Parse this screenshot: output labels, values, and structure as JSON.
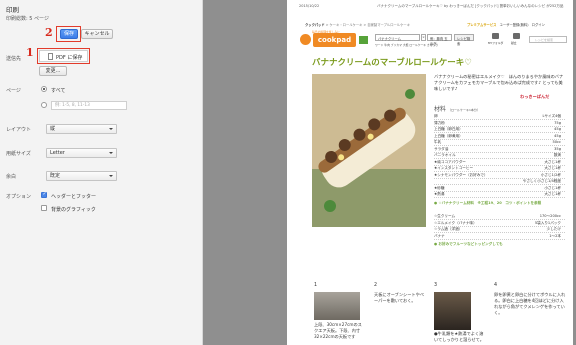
{
  "dialog": {
    "title": "印刷",
    "total_pages": "印刷総数: 5 ページ",
    "save_label": "保存",
    "cancel_label": "キャンセル",
    "destination_label": "送信先",
    "destination_value": "PDF に保存",
    "change_label": "変更...",
    "pages_label": "ページ",
    "pages_all": "すべて",
    "pages_placeholder": "例: 1-5, 8, 11-13",
    "layout_label": "レイアウト",
    "layout_value": "縦",
    "paper_label": "用紙サイズ",
    "paper_value": "Letter",
    "margin_label": "余白",
    "margin_value": "既定",
    "options_label": "オプション",
    "opt_header_footer": "ヘッダーとフッター",
    "opt_background": "背景のグラフィック"
  },
  "annotations": {
    "num1": "1",
    "num2": "2"
  },
  "preview": {
    "date": "2015/10/22",
    "header_title": "バナナクリームのマーブルロールケーキ♡ by わっきーぱんだ [クックパッド] 簡単おいしいみんなのレシピ が252万品",
    "crumb_a": "クックパッド",
    "crumb_b": "> ケーキ・ロールケーキ > 自家製マーブルロールケーキ",
    "top_premium": "プレミアムサービス",
    "top_register": "ユーザー登録(無料)",
    "top_login": "ログイン",
    "logo": "cookpad",
    "logo_sub": "毎日の料理を楽しみに",
    "search_value": "バナナクリーム",
    "search_x": "×",
    "search_ph2": "例：豚肉 玉ねぎ",
    "search_btn": "レシピ検索",
    "search_hints": "ワード 牛肉 ブリカマ 大根 ロールケーキ きゅうり",
    "nav_mykitchen": "MYフォルダ",
    "nav_menu": "献立",
    "nav_search_ph": "レシピを検索",
    "recipe_title": "バナナクリームのマーブルロールケーキ♡",
    "description": "バナナクリームの秘密はエルメイク♡　ほんのりまろやか風味のバナナクリームをカフェモカマーブルで包み込めば完成です♪ とっても美味しいです♪",
    "tsukurepo": "わっきーぱんだ",
    "ing_title": "材料",
    "ing_note": "（ロールケーキ1本分）",
    "ingredients": [
      {
        "name": "卵",
        "value": "Lサイズ4個"
      },
      {
        "name": "薄力粉",
        "value": "75g"
      },
      {
        "name": "上白糖（卵白用）",
        "value": "45g"
      },
      {
        "name": "上白糖（卵黄用）",
        "value": "45g"
      },
      {
        "name": "牛乳",
        "value": "50cc"
      },
      {
        "name": "サラダ油",
        "value": "35g"
      },
      {
        "name": "バニラオイル",
        "value": "数滴"
      },
      {
        "name": "★純ココアパウダー",
        "value": "大さじ1杯"
      },
      {
        "name": "★インスタントコーヒー",
        "value": "大さじ1杯"
      },
      {
        "name": "★シナモンパウダー（お好みで）",
        "value": "小さじ1/2杯"
      },
      {
        "name": "",
        "value": "やさしく小さじ1/4程度"
      },
      {
        "name": "★砂糖",
        "value": "小さじ1杯"
      },
      {
        "name": "★熱湯",
        "value": "大さじ1杯"
      }
    ],
    "cream_head": "● ☆バナナクリーム材料　※工程19、20　コツ・ポイントを参照",
    "cream": [
      {
        "name": "☆生クリーム",
        "value": "170〜200cc"
      },
      {
        "name": "☆エルメイク（バナナ味）",
        "value": "5袋入り1パック"
      },
      {
        "name": "☆ラム酒（洋酒）",
        "value": "少したけ"
      },
      {
        "name": "バナナ",
        "value": "1〜2本"
      }
    ],
    "fruit_head": "● お好みでフルーツなどトッピングしても",
    "step1_num": "1",
    "step2_num": "2",
    "step3_num": "3",
    "step4_num": "4",
    "step1_text": "上段、30cm×27cmのスクエア天板。下段、内寸32×22cmの天板です",
    "step2_text": "天板にオーブンシートやペーパーを敷いておく。",
    "step3_text": "●牛乳類を★熱湯でよく溶いてしっかりと湿らせて。",
    "step4_text": "卵を卵黄と卵白に分けてボウルに入れる。卵白に上白糖を4回ほどに分け入れながら角がてクメレンゲを作っていく。"
  },
  "colors": {
    "accent_blue": "#3b7de8",
    "annotation_red": "#d8281b",
    "cookpad_orange": "#f08a24",
    "title_green": "#7a9a1c"
  }
}
